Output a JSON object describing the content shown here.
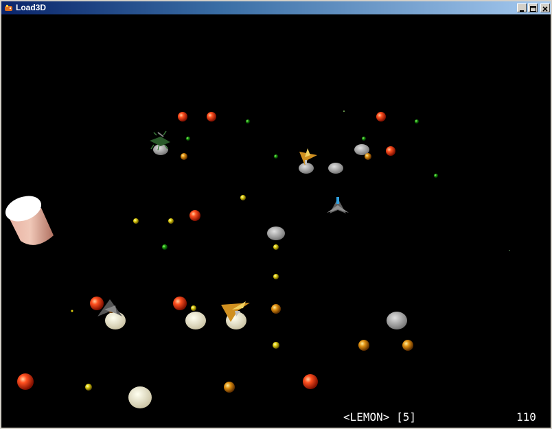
{
  "window": {
    "title": "Load3D",
    "icon": "game-controller-icon",
    "controls": [
      "minimize-icon",
      "maximize-icon",
      "close-icon"
    ]
  },
  "hud": {
    "weapon": "<LEMON> [5]",
    "score": "110",
    "energy_fraction": 1.0
  },
  "colors": {
    "background": "#000000",
    "titlebar_start": "#0a246a",
    "titlebar_end": "#a6caf0"
  }
}
